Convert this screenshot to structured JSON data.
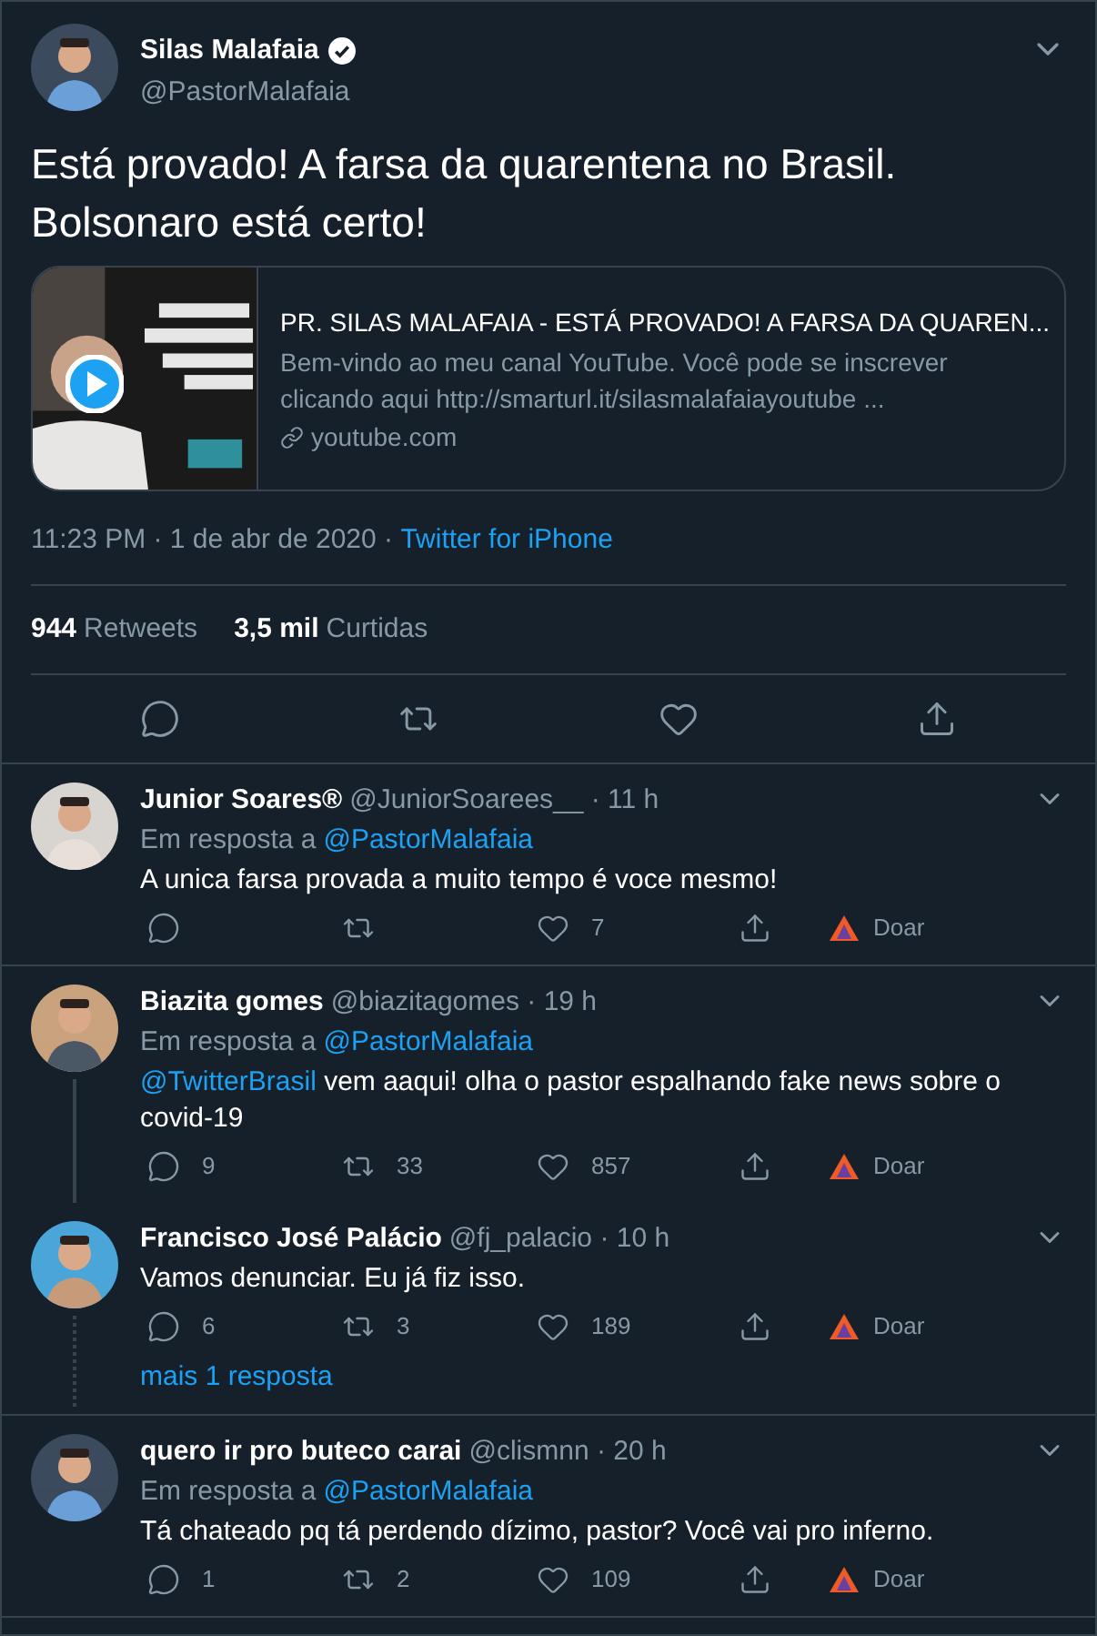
{
  "main_tweet": {
    "author": {
      "name": "Silas Malafaia",
      "verified": true,
      "handle": "@PastorMalafaia"
    },
    "text": "Está provado! A farsa da quarentena no Brasil. Bolsonaro está certo!",
    "card": {
      "title": "PR. SILAS MALAFAIA - ESTÁ PROVADO! A FARSA DA QUAREN...",
      "description": "Bem-vindo ao meu canal YouTube. Você pode se inscrever clicando aqui http://smarturl.it/silasmalafaiayoutube ...",
      "domain": "youtube.com"
    },
    "timestamp": "11:23 PM · 1 de abr de 2020 · ",
    "source": "Twitter for iPhone",
    "stats": [
      {
        "count": "944",
        "label": "Retweets"
      },
      {
        "count": "3,5 mil",
        "label": "Curtidas"
      }
    ],
    "actions": [
      {
        "kind": "reply"
      },
      {
        "kind": "retweet"
      },
      {
        "kind": "like"
      },
      {
        "kind": "share"
      }
    ]
  },
  "replies": [
    {
      "name": "Junior Soares®",
      "handle": "@JuniorSoarees__ · 11 h",
      "reply_prefix": "Em resposta a",
      "reply_to": "@PastorMalafaia",
      "text": "A unica farsa provada a muito tempo é voce mesmo!",
      "thread_below": false,
      "actions": [
        {
          "kind": "reply"
        },
        {
          "kind": "retweet"
        },
        {
          "kind": "like",
          "count": "7"
        },
        {
          "kind": "share"
        },
        {
          "kind": "donate",
          "label": "Doar"
        }
      ]
    },
    {
      "name": "Biazita gomes",
      "handle": "@biazitagomes · 19 h",
      "reply_prefix": "Em resposta a",
      "reply_to": "@PastorMalafaia",
      "mention": "@TwitterBrasil",
      "text": " vem aaqui! olha o pastor espalhando fake news sobre o covid-19",
      "thread_below": true,
      "actions": [
        {
          "kind": "reply",
          "count": "9"
        },
        {
          "kind": "retweet",
          "count": "33"
        },
        {
          "kind": "like",
          "count": "857"
        },
        {
          "kind": "share"
        },
        {
          "kind": "donate",
          "label": "Doar"
        }
      ]
    },
    {
      "name": "Francisco José Palácio",
      "handle": "@fj_palacio · 10 h",
      "text": "Vamos denunciar. Eu já fiz isso.",
      "thread_below": false,
      "more_replies": "mais 1 resposta",
      "actions": [
        {
          "kind": "reply",
          "count": "6"
        },
        {
          "kind": "retweet",
          "count": "3"
        },
        {
          "kind": "like",
          "count": "189"
        },
        {
          "kind": "share"
        },
        {
          "kind": "donate",
          "label": "Doar"
        }
      ]
    },
    {
      "name": "quero ir pro buteco carai",
      "handle": "@clismnn · 20 h",
      "reply_prefix": "Em resposta a",
      "reply_to": "@PastorMalafaia",
      "text": "Tá chateado pq tá perdendo dízimo, pastor? Você vai pro inferno.",
      "thread_below": false,
      "actions": [
        {
          "kind": "reply",
          "count": "1"
        },
        {
          "kind": "retweet",
          "count": "2"
        },
        {
          "kind": "like",
          "count": "109"
        },
        {
          "kind": "share"
        },
        {
          "kind": "donate",
          "label": "Doar"
        }
      ]
    }
  ]
}
